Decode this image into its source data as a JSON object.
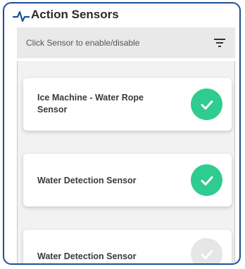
{
  "header": {
    "title": "Action Sensors",
    "icon": "pulse-icon",
    "accent_color": "#1a4f9c"
  },
  "filter_bar": {
    "hint": "Click Sensor to enable/disable",
    "icon": "filter-icon"
  },
  "sensors": [
    {
      "label": "Ice Machine - Water Rope Sensor",
      "enabled": true
    },
    {
      "label": "Water Detection Sensor",
      "enabled": true
    },
    {
      "label": "Water Detection Sensor",
      "enabled": false
    }
  ],
  "colors": {
    "enabled": "#2ecc8f",
    "disabled": "#e6e6e6"
  }
}
